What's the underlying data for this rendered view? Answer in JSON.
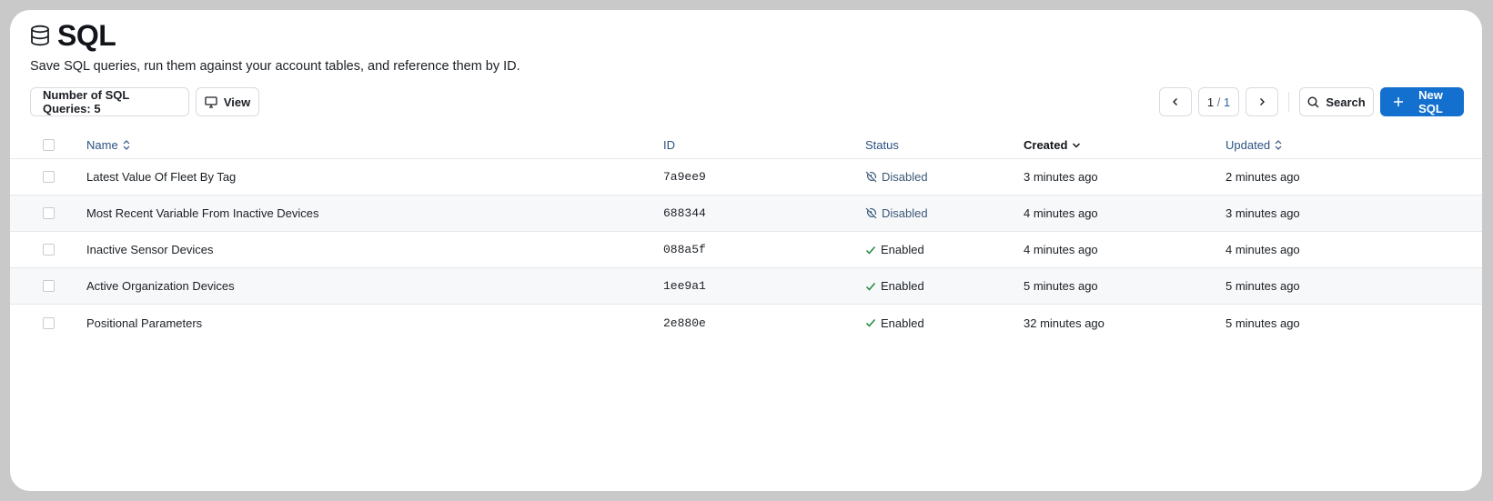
{
  "page": {
    "title": "SQL",
    "subtitle": "Save SQL queries, run them against your account tables, and reference them by ID.",
    "icon": "database-icon"
  },
  "toolbar": {
    "count_label": "Number of SQL Queries: 5",
    "view_label": "View",
    "page_current": "1",
    "page_sep": " / ",
    "page_total": "1",
    "search_label": "Search",
    "new_label": "New SQL"
  },
  "table": {
    "columns": {
      "name": "Name",
      "id": "ID",
      "status": "Status",
      "created": "Created",
      "updated": "Updated"
    },
    "rows": [
      {
        "name": "Latest Value Of Fleet By Tag",
        "id": "7a9ee9",
        "status": "Disabled",
        "created": "3 minutes ago",
        "updated": "2 minutes ago"
      },
      {
        "name": "Most Recent Variable From Inactive Devices",
        "id": "688344",
        "status": "Disabled",
        "created": "4 minutes ago",
        "updated": "3 minutes ago"
      },
      {
        "name": "Inactive Sensor Devices",
        "id": "088a5f",
        "status": "Enabled",
        "created": "4 minutes ago",
        "updated": "4 minutes ago"
      },
      {
        "name": "Active Organization Devices",
        "id": "1ee9a1",
        "status": "Enabled",
        "created": "5 minutes ago",
        "updated": "5 minutes ago"
      },
      {
        "name": "Positional Parameters",
        "id": "2e880e",
        "status": "Enabled",
        "created": "32 minutes ago",
        "updated": "5 minutes ago"
      }
    ]
  },
  "colors": {
    "accent": "#1370cf",
    "disabled_text": "#3d5878",
    "enabled_check": "#1f8a3b",
    "row_alt": "#f6f8fa"
  }
}
